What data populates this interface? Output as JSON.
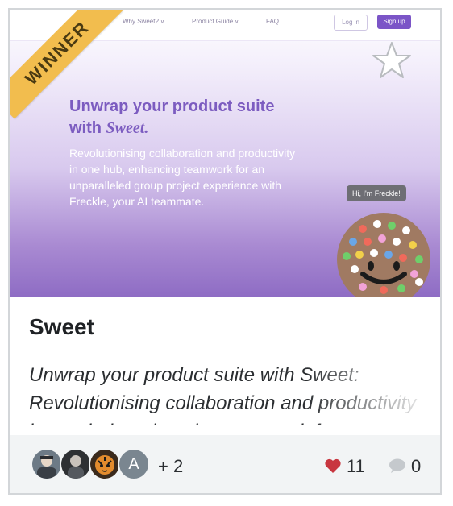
{
  "hero": {
    "nav": [
      {
        "label": "Why Sweet?"
      },
      {
        "label": "Product Guide"
      },
      {
        "label": "FAQ"
      }
    ],
    "login_label": "Log in",
    "signup_label": "Sign up",
    "ribbon_text": "WINNER",
    "headline_prefix": "Unwrap your product suite",
    "headline_with": "with ",
    "headline_brand": "Sweet.",
    "subtext": "Revolutionising collaboration and productivity in one hub, enhancing teamwork for an unparalleled group project experience with Freckle, your AI teammate.",
    "chat_bubble": "Hi, I'm Freckle!"
  },
  "card": {
    "title": "Sweet",
    "description": "Unwrap your product suite with Sweet: Revolutionising collaboration and productivity in one hub, enhancing teamwork for an unparalleled group project experience with Freckle, your AI teammate."
  },
  "footer": {
    "avatars": [
      {
        "kind": "photo",
        "icon": "person-photo-icon"
      },
      {
        "kind": "photo",
        "icon": "person-photo-icon"
      },
      {
        "kind": "photo",
        "icon": "tiger-photo-icon"
      },
      {
        "kind": "letter",
        "letter": "A"
      }
    ],
    "more_count": "+ 2",
    "likes": "11",
    "comments": "0"
  },
  "colors": {
    "accent": "#7b55c7",
    "ribbon": "#f2bd4e",
    "heart": "#c8363f",
    "comment_icon": "#c5c9cd"
  }
}
